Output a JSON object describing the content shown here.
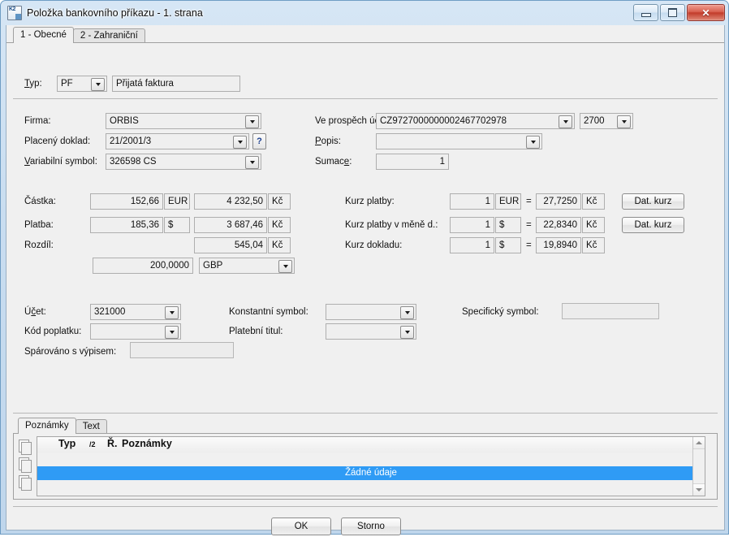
{
  "window": {
    "title": "Položka bankovního příkazu - 1. strana",
    "icon": "k2-app-icon",
    "buttons": {
      "minimize": "minimize",
      "maximize": "maximize",
      "close": "close"
    }
  },
  "tabs": [
    {
      "label": "1 - Obecné",
      "active": true
    },
    {
      "label": "2 - Zahraniční",
      "active": false
    }
  ],
  "type_row": {
    "label": "Typ:",
    "code": "PF",
    "description": "Přijatá faktura"
  },
  "left_block": {
    "firma": {
      "label": "Firma:",
      "value": "ORBIS"
    },
    "placeny_doklad": {
      "label": "Placený doklad:",
      "value": "21/2001/3",
      "help_button": "?"
    },
    "variabilni_symbol": {
      "label": "Variabilní symbol:",
      "value": "326598 CS"
    }
  },
  "right_block": {
    "ve_prospech_uctu": {
      "label": "Ve prospěch účtu:",
      "value": "CZ9727000000002467702978",
      "bank_code": "2700"
    },
    "popis": {
      "label": "Popis:",
      "value": ""
    },
    "sumace": {
      "label": "Sumace:",
      "value": "1"
    }
  },
  "amounts": {
    "castka": {
      "label": "Částka:",
      "amount": "152,66",
      "currency": "EUR",
      "amount_czk": "4 232,50",
      "currency_czk": "Kč"
    },
    "platba": {
      "label": "Platba:",
      "amount": "185,36",
      "currency": "$",
      "amount_czk": "3 687,46",
      "currency_czk": "Kč"
    },
    "rozdil": {
      "label": "Rozdíl:",
      "amount_czk": "545,04",
      "currency_czk": "Kč"
    },
    "extra": {
      "amount": "200,0000",
      "currency": "GBP"
    }
  },
  "rates": {
    "kurz_platby": {
      "label": "Kurz platby:",
      "base": "1",
      "base_currency": "EUR",
      "eq": "=",
      "rate": "27,7250",
      "currency": "Kč",
      "button": "Dat. kurz"
    },
    "kurz_platby_v_mene": {
      "label": "Kurz platby v měně d.:",
      "base": "1",
      "base_currency": "$",
      "eq": "=",
      "rate": "22,8340",
      "currency": "Kč",
      "button": "Dat. kurz"
    },
    "kurz_dokladu": {
      "label": "Kurz dokladu:",
      "base": "1",
      "base_currency": "$",
      "eq": "=",
      "rate": "19,8940",
      "currency": "Kč"
    }
  },
  "accounting": {
    "ucet": {
      "label": "Účet:",
      "value": "321000"
    },
    "kod_poplatku": {
      "label": "Kód poplatku:",
      "value": ""
    },
    "sparovano": {
      "label": "Spárováno s výpisem:",
      "value": ""
    },
    "konstantni_symbol": {
      "label": "Konstantní symbol:",
      "value": ""
    },
    "platebni_titul": {
      "label": "Platební titul:",
      "value": ""
    },
    "specificky_symbol": {
      "label": "Specifický symbol:",
      "value": ""
    }
  },
  "notes_panel": {
    "tabs": [
      {
        "label": "Poznámky",
        "active": true
      },
      {
        "label": "Text",
        "active": false
      }
    ],
    "side_buttons": [
      "document-new-icon",
      "document-image-icon",
      "document-list-icon"
    ],
    "grid": {
      "columns": [
        "Typ",
        "/2",
        "Ř.",
        "Poznámky"
      ],
      "empty_message": "Žádné údaje"
    }
  },
  "footer": {
    "ok": "OK",
    "cancel": "Storno"
  },
  "colors": {
    "selection": "#2f9bf5",
    "title_gradient_top": "#d6e6f5",
    "close_button": "#c23b2a",
    "field_bg": "#efefef"
  }
}
